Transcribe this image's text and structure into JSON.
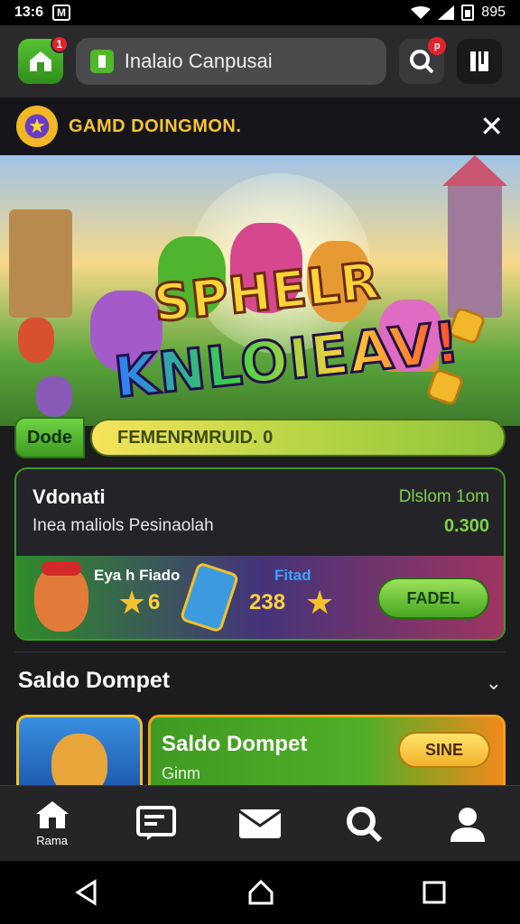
{
  "status_bar": {
    "time": "13:6",
    "app_badge": "M",
    "battery": "895"
  },
  "header": {
    "home_badge": "1",
    "search_placeholder": "Inalaio Canpusai",
    "notif_badge": "p"
  },
  "promo": {
    "title": "GAMD DOINGMON.",
    "close_label": "✕",
    "hero_line1": "SPHELR",
    "hero_line2": "KNLOIEAV!"
  },
  "code_row": {
    "button_label": "Dode",
    "field_value": "FEMENRMRUID. 0"
  },
  "reward_card": {
    "title": "Vdonati",
    "date": "Dlslom 1om",
    "description": "Inea maliols Pesinaolah",
    "amount": "0.300",
    "item1_label": "Eya h Fiado",
    "item1_value": "6",
    "item2_label": "Fitad",
    "item2_value": "238",
    "claim_label": "FADEL"
  },
  "saldo": {
    "heading": "Saldo Dompet",
    "card_title": "Saldo Dompet",
    "card_subtitle": "Ginm",
    "card_button": "SINE"
  },
  "bottom_nav": {
    "items": [
      {
        "label": "Rama",
        "icon": "home-icon"
      },
      {
        "label": "",
        "icon": "ticket-icon"
      },
      {
        "label": "",
        "icon": "mail-icon"
      },
      {
        "label": "",
        "icon": "search-icon"
      },
      {
        "label": "",
        "icon": "profile-icon"
      }
    ]
  },
  "colors": {
    "accent_green": "#4fb82c",
    "gold": "#f4c430",
    "badge_red": "#e0242e"
  }
}
